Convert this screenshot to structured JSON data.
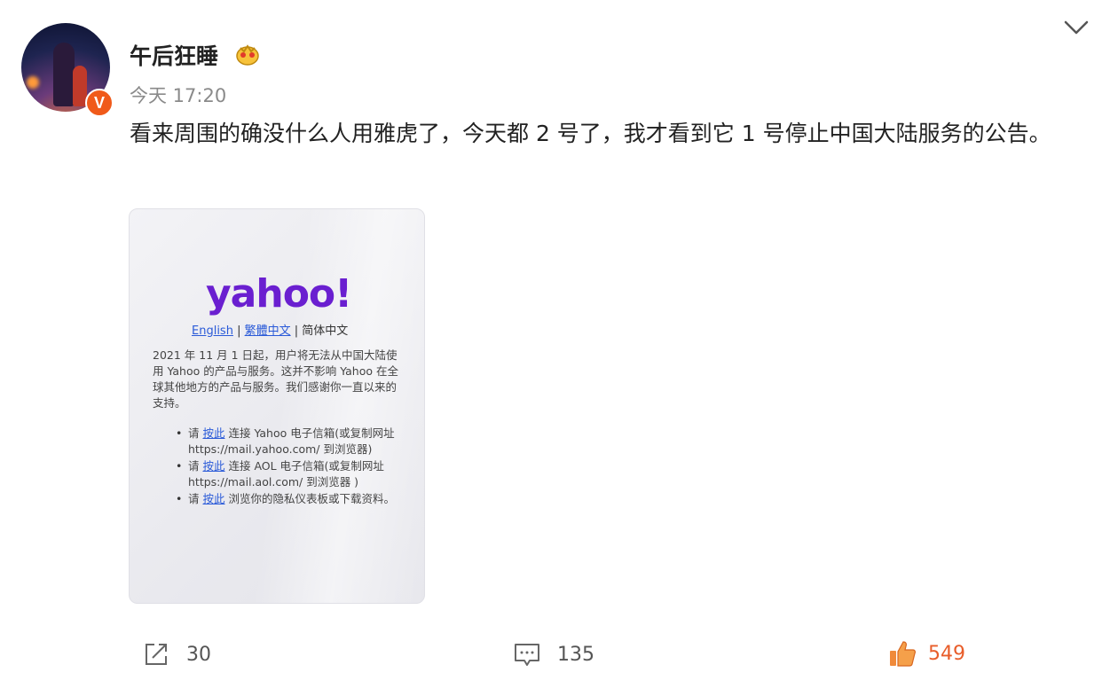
{
  "user": {
    "name": "午后狂睡",
    "time": "今天 17:20",
    "verified_mark": "V"
  },
  "post": {
    "text": "看来周围的确没什么人用雅虎了，今天都 2 号了，我才看到它 1 号停止中国大陆服务的公告。"
  },
  "image": {
    "logo": "yahoo!",
    "lang_english": "English",
    "lang_sep1": " | ",
    "lang_traditional": "繁體中文",
    "lang_sep2": " | ",
    "lang_simplified": "简体中文",
    "notice": "2021 年 11 月 1 日起，用户将无法从中国大陆使用 Yahoo 的产品与服务。这并不影响 Yahoo 在全球其他地方的产品与服务。我们感谢你一直以来的支持。",
    "bullets": [
      {
        "pre": "请 ",
        "link": "按此",
        "post": " 连接 Yahoo 电子信箱(或复制网址 https://mail.yahoo.com/ 到浏览器)"
      },
      {
        "pre": "请 ",
        "link": "按此",
        "post": " 连接 AOL 电子信箱(或复制网址 https://mail.aol.com/ 到浏览器 )"
      },
      {
        "pre": "请 ",
        "link": "按此",
        "post": " 浏览你的隐私仪表板或下载资料。"
      }
    ]
  },
  "actions": {
    "share_count": "30",
    "comment_count": "135",
    "like_count": "549"
  },
  "colors": {
    "accent_orange": "#e85d2a",
    "yahoo_purple": "#6a1fd0",
    "link_blue": "#2a5ad8"
  },
  "icons": [
    "crown-icon",
    "chevron-down-icon",
    "share-icon",
    "comment-icon",
    "thumbs-up-icon"
  ]
}
